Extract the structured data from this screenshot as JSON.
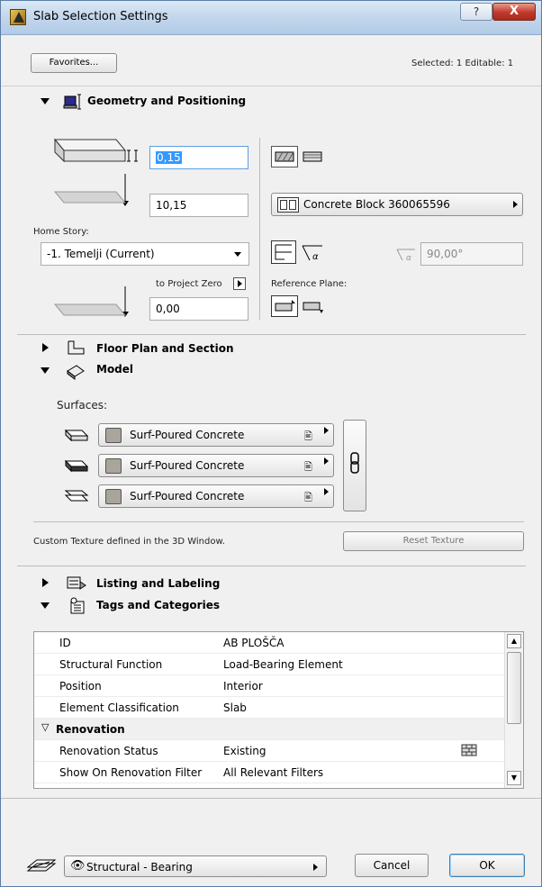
{
  "window": {
    "title": "Slab Selection Settings",
    "help_label": "?",
    "close_label": "X"
  },
  "header": {
    "favorites_label": "Favorites...",
    "selected_info": "Selected: 1 Editable: 1"
  },
  "geometry": {
    "title": "Geometry and Positioning",
    "thickness_value": "0,15",
    "offset_value": "10,15",
    "home_story_label": "Home Story:",
    "home_story_value": "-1. Temelji (Current)",
    "to_project_zero_label": "to Project Zero",
    "project_zero_value": "0,00",
    "building_material_label": "Concrete Block 360065596",
    "angle_value": "90,00°",
    "reference_plane_label": "Reference Plane:"
  },
  "floor_plan": {
    "title": "Floor Plan and Section"
  },
  "model": {
    "title": "Model",
    "surfaces_label": "Surfaces:",
    "surfaces": [
      {
        "label": "Surf-Poured Concrete"
      },
      {
        "label": "Surf-Poured Concrete"
      },
      {
        "label": "Surf-Poured Concrete"
      }
    ],
    "custom_texture_label": "Custom Texture defined in the 3D Window.",
    "reset_texture_label": "Reset Texture"
  },
  "listing": {
    "title": "Listing and Labeling"
  },
  "tags": {
    "title": "Tags and Categories",
    "rows": [
      {
        "key": "ID",
        "value": "AB PLOŠČA"
      },
      {
        "key": "Structural Function",
        "value": "Load-Bearing Element"
      },
      {
        "key": "Position",
        "value": "Interior"
      },
      {
        "key": "Element Classification",
        "value": "Slab"
      }
    ],
    "renovation_group": "Renovation",
    "renovation_rows": [
      {
        "key": "Renovation Status",
        "value": "Existing"
      },
      {
        "key": "Show On Renovation Filter",
        "value": "All Relevant Filters"
      }
    ]
  },
  "footer": {
    "layer_value": "Structural - Bearing",
    "cancel_label": "Cancel",
    "ok_label": "OK"
  },
  "colors": {
    "accent": "#3399ff",
    "close": "#c0392b",
    "swatch": "#a9a59a"
  }
}
